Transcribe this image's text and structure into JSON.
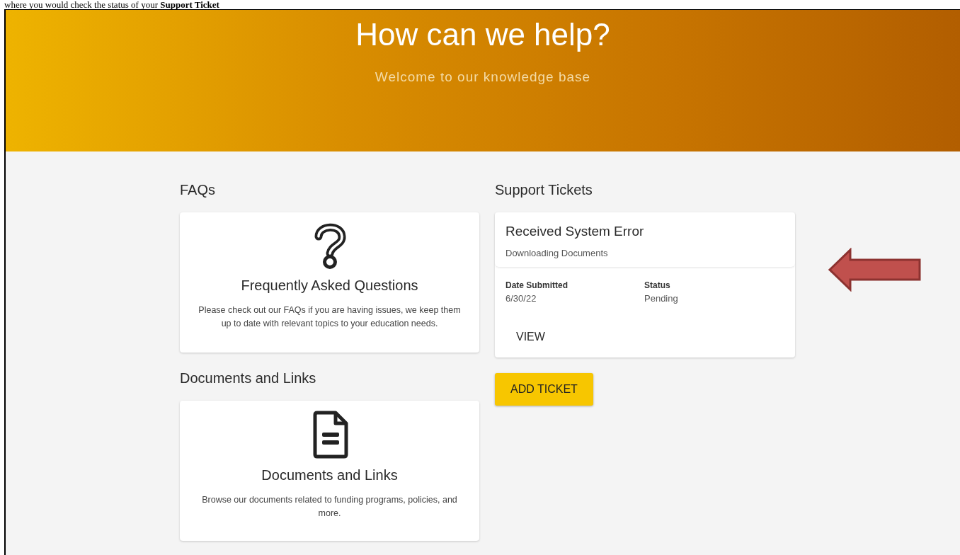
{
  "caption": "where you would check the status of your **Support Ticket**",
  "hero": {
    "title": "How can we help?",
    "subtitle": "Welcome to our knowledge base"
  },
  "sections": [
    {
      "heading": "FAQs",
      "card": {
        "kind": "faq",
        "title": "Frequently Asked Questions",
        "text": "Please check out our FAQs if you are having issues, we keep them up to date with relevant topics to your education needs."
      }
    },
    {
      "heading": "Documents and Links",
      "card": {
        "kind": "document",
        "title": "Documents and Links",
        "text": "Browse our documents related to funding programs, policies, and more."
      }
    }
  ],
  "support": {
    "heading": "Support Tickets",
    "tickets": [
      {
        "title": "Received System Error",
        "subtitle": "Downloading Documents",
        "fields": [
          {
            "label": "Date Submitted",
            "value": "6/30/22"
          },
          {
            "label": "Status",
            "value": "Pending"
          }
        ],
        "action": "VIEW"
      }
    ],
    "add_button": "ADD TICKET"
  }
}
